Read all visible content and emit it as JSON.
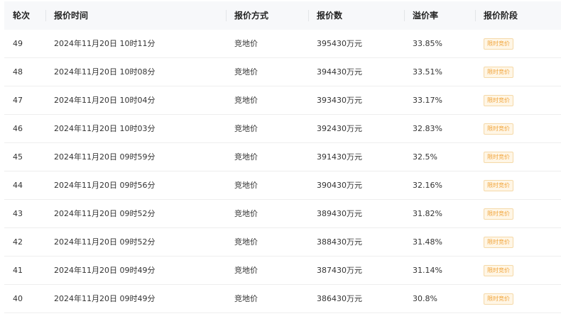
{
  "table": {
    "headers": [
      "轮次",
      "报价时间",
      "报价方式",
      "报价数",
      "溢价率",
      "报价阶段"
    ],
    "rows": [
      {
        "round": "49",
        "time": "2024年11月20日 10时11分",
        "method": "竞地价",
        "amount": "395430万元",
        "premium": "33.85%",
        "stage": "限时竞价"
      },
      {
        "round": "48",
        "time": "2024年11月20日 10时08分",
        "method": "竞地价",
        "amount": "394430万元",
        "premium": "33.51%",
        "stage": "限时竞价"
      },
      {
        "round": "47",
        "time": "2024年11月20日 10时04分",
        "method": "竞地价",
        "amount": "393430万元",
        "premium": "33.17%",
        "stage": "限时竞价"
      },
      {
        "round": "46",
        "time": "2024年11月20日 10时03分",
        "method": "竞地价",
        "amount": "392430万元",
        "premium": "32.83%",
        "stage": "限时竞价"
      },
      {
        "round": "45",
        "time": "2024年11月20日 09时59分",
        "method": "竞地价",
        "amount": "391430万元",
        "premium": "32.5%",
        "stage": "限时竞价"
      },
      {
        "round": "44",
        "time": "2024年11月20日 09时56分",
        "method": "竞地价",
        "amount": "390430万元",
        "premium": "32.16%",
        "stage": "限时竞价"
      },
      {
        "round": "43",
        "time": "2024年11月20日 09时52分",
        "method": "竞地价",
        "amount": "389430万元",
        "premium": "31.82%",
        "stage": "限时竞价"
      },
      {
        "round": "42",
        "time": "2024年11月20日 09时52分",
        "method": "竞地价",
        "amount": "388430万元",
        "premium": "31.48%",
        "stage": "限时竞价"
      },
      {
        "round": "41",
        "time": "2024年11月20日 09时49分",
        "method": "竞地价",
        "amount": "387430万元",
        "premium": "31.14%",
        "stage": "限时竞价"
      },
      {
        "round": "40",
        "time": "2024年11月20日 09时49分",
        "method": "竞地价",
        "amount": "386430万元",
        "premium": "30.8%",
        "stage": "限时竞价"
      }
    ]
  },
  "colors": {
    "header_bg": "#f7f8fa",
    "badge_text": "#f0a43a",
    "badge_bg": "#fff6e6",
    "badge_border": "#f5d9a8"
  }
}
